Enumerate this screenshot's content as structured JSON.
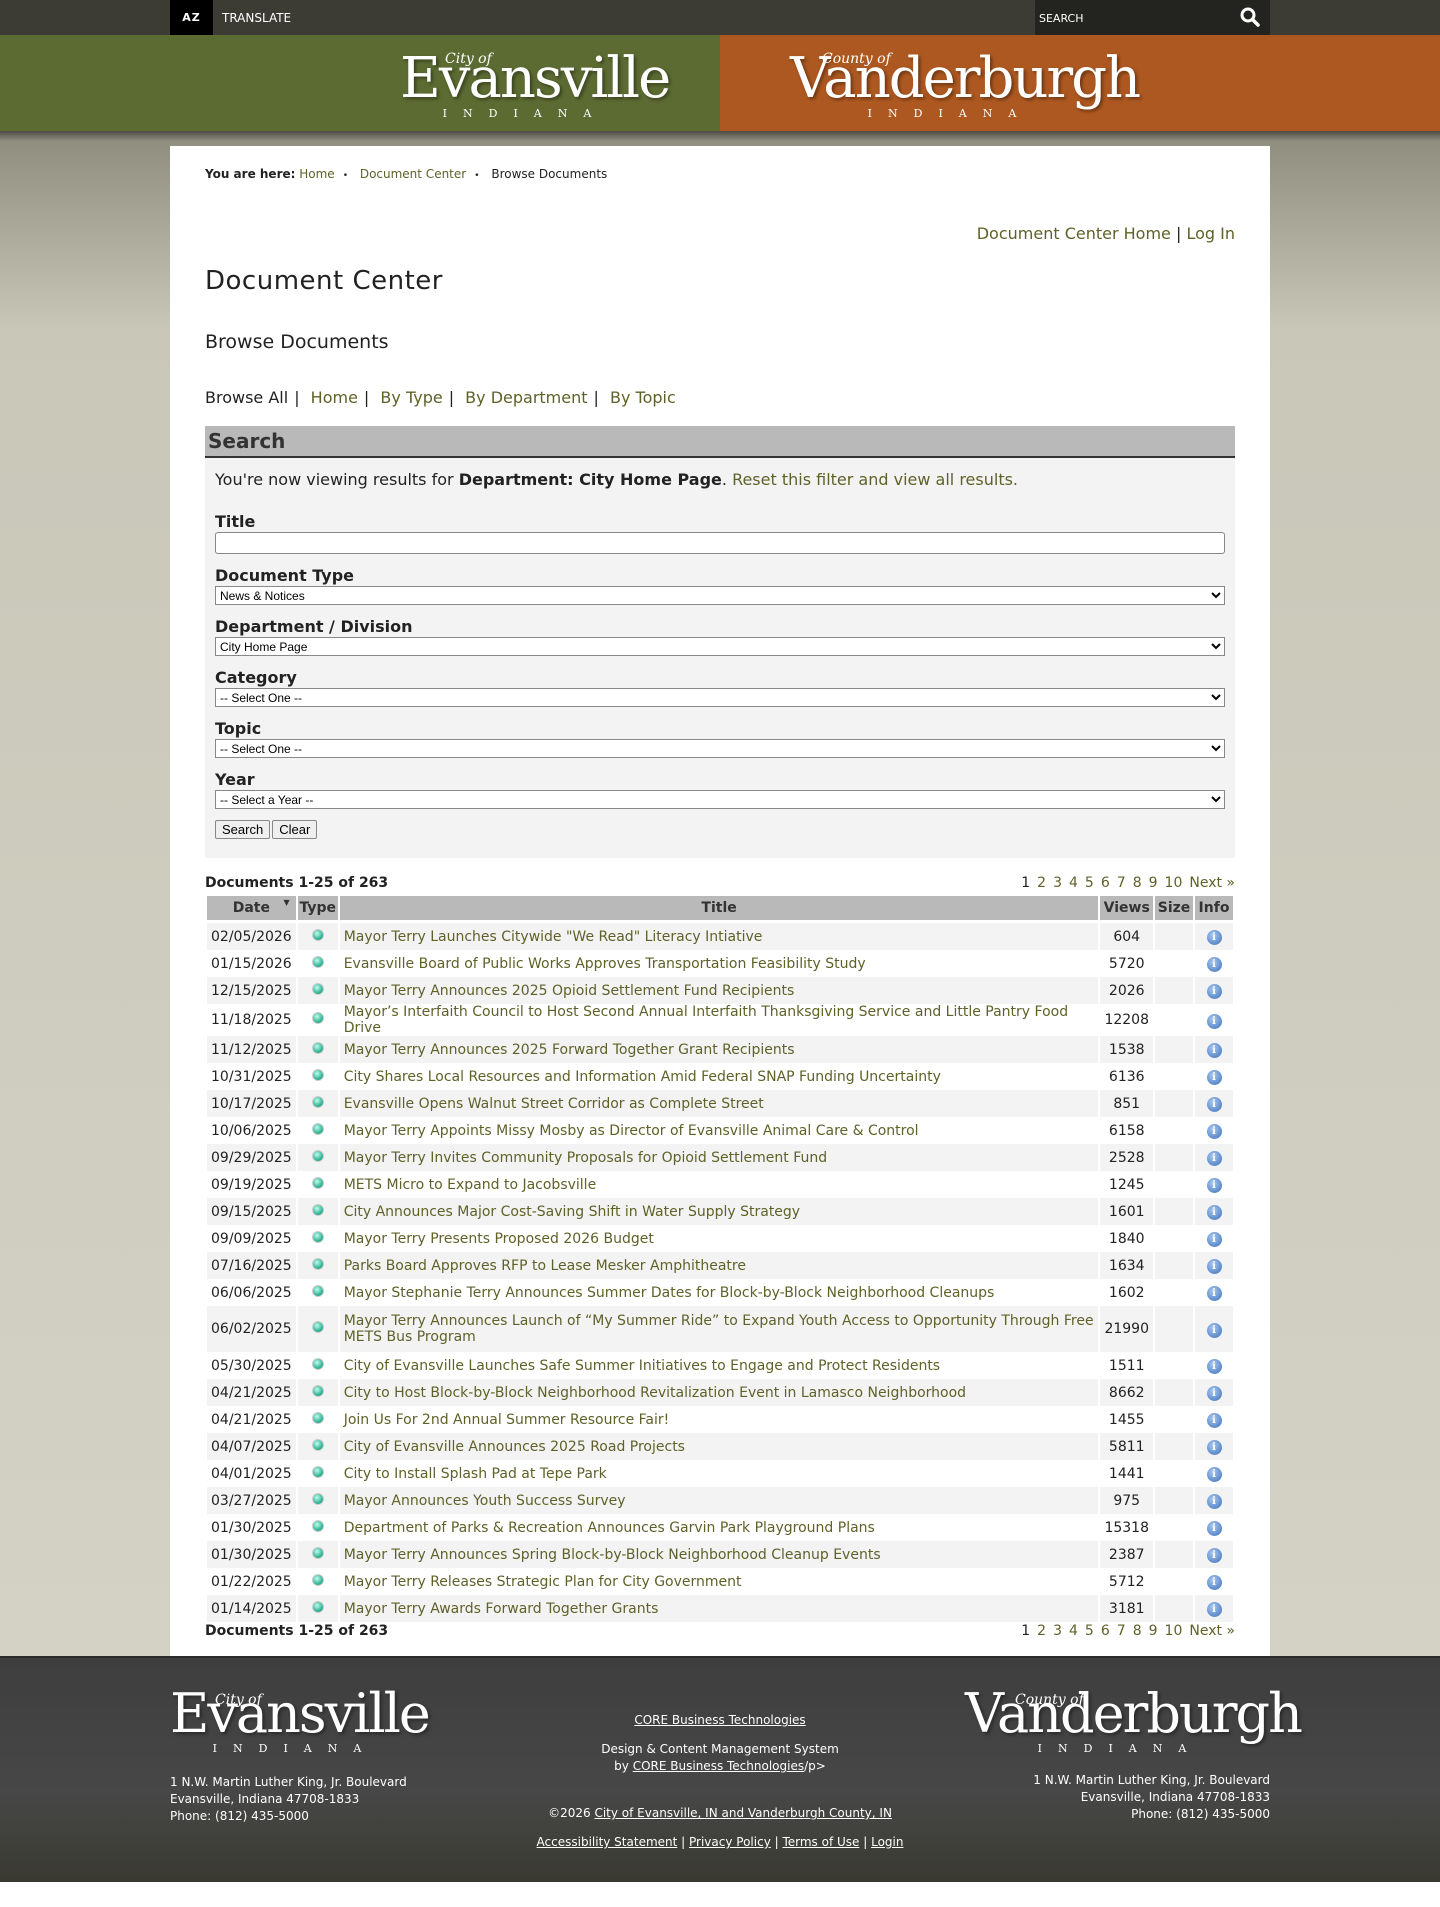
{
  "topbar": {
    "translate": "TRANSLATE",
    "translate_icon": "AZ",
    "search_placeholder": "SEARCH"
  },
  "logos": {
    "city_of": "City of",
    "evansville": "Evansville",
    "county_of": "County of",
    "vanderburgh": "Vanderburgh",
    "indiana": "INDIANA"
  },
  "breadcrumb": {
    "label": "You are here:",
    "items": [
      "Home",
      "Document Center",
      "Browse Documents"
    ]
  },
  "top_links": [
    "Document Center Home",
    "Log In"
  ],
  "page_title": "Document Center",
  "subtitle": "Browse Documents",
  "browse": {
    "current": "Browse All",
    "links": [
      "Home",
      "By Type",
      "By Department",
      "By Topic"
    ]
  },
  "search": {
    "heading": "Search",
    "msg_prefix": "You're now viewing results for ",
    "msg_bold": "Department: City Home Page",
    "msg_link": "Reset this filter and view all results.",
    "title_label": "Title",
    "title_value": "",
    "doctype_label": "Document Type",
    "doctype_value": "News & Notices",
    "dept_label": "Department / Division",
    "dept_value": "City Home Page",
    "category_label": "Category",
    "category_value": "-- Select One --",
    "topic_label": "Topic",
    "topic_value": "-- Select One --",
    "year_label": "Year",
    "year_value": "-- Select a Year --",
    "search_btn": "Search",
    "clear_btn": "Clear"
  },
  "results": {
    "count": "Documents 1-25 of 263",
    "pages": [
      "1",
      "2",
      "3",
      "4",
      "5",
      "6",
      "7",
      "8",
      "9",
      "10"
    ],
    "next": "Next »",
    "columns": [
      "Date",
      "Type",
      "Title",
      "Views",
      "Size",
      "Info"
    ],
    "rows": [
      [
        "02/05/2026",
        "Mayor Terry Launches Citywide \"We Read\" Literacy Intiative",
        "604"
      ],
      [
        "01/15/2026",
        "Evansville Board of Public Works Approves Transportation Feasibility Study",
        "5720"
      ],
      [
        "12/15/2025",
        "Mayor Terry Announces 2025 Opioid Settlement Fund Recipients",
        "2026"
      ],
      [
        "11/18/2025",
        "Mayor’s Interfaith Council to Host Second Annual Interfaith Thanksgiving Service and Little Pantry Food Drive",
        "12208"
      ],
      [
        "11/12/2025",
        "Mayor Terry Announces 2025 Forward Together Grant Recipients",
        "1538"
      ],
      [
        "10/31/2025",
        "City Shares Local Resources and Information Amid Federal SNAP Funding Uncertainty",
        "6136"
      ],
      [
        "10/17/2025",
        "Evansville Opens Walnut Street Corridor as Complete Street",
        "851"
      ],
      [
        "10/06/2025",
        "Mayor Terry Appoints Missy Mosby as Director of Evansville Animal Care & Control",
        "6158"
      ],
      [
        "09/29/2025",
        "Mayor Terry Invites Community Proposals for Opioid Settlement Fund",
        "2528"
      ],
      [
        "09/19/2025",
        "METS Micro to Expand to Jacobsville",
        "1245"
      ],
      [
        "09/15/2025",
        "City Announces Major Cost-Saving Shift in Water Supply Strategy",
        "1601"
      ],
      [
        "09/09/2025",
        "Mayor Terry Presents Proposed 2026 Budget",
        "1840"
      ],
      [
        "07/16/2025",
        "Parks Board Approves RFP to Lease Mesker Amphitheatre",
        "1634"
      ],
      [
        "06/06/2025",
        "Mayor Stephanie Terry Announces Summer Dates for Block-by-Block Neighborhood Cleanups",
        "1602"
      ],
      [
        "06/02/2025",
        "Mayor Terry Announces Launch of “My Summer Ride” to Expand Youth Access to Opportunity Through Free METS Bus Program",
        "21990"
      ],
      [
        "05/30/2025",
        "City of Evansville Launches Safe Summer Initiatives to Engage and Protect Residents",
        "1511"
      ],
      [
        "04/21/2025",
        "City to Host Block-by-Block Neighborhood Revitalization Event in Lamasco Neighborhood",
        "8662"
      ],
      [
        "04/21/2025",
        "Join Us For 2nd Annual Summer Resource Fair!",
        "1455"
      ],
      [
        "04/07/2025",
        "City of Evansville Announces 2025 Road Projects",
        "5811"
      ],
      [
        "04/01/2025",
        "City to Install Splash Pad at Tepe Park",
        "1441"
      ],
      [
        "03/27/2025",
        "Mayor Announces Youth Success Survey",
        "975"
      ],
      [
        "01/30/2025",
        "Department of Parks & Recreation Announces Garvin Park Playground Plans",
        "15318"
      ],
      [
        "01/30/2025",
        "Mayor Terry Announces Spring Block-by-Block Neighborhood Cleanup Events",
        "2387"
      ],
      [
        "01/22/2025",
        "Mayor Terry Releases Strategic Plan for City Government",
        "5712"
      ],
      [
        "01/14/2025",
        "Mayor Terry Awards Forward Together Grants",
        "3181"
      ]
    ]
  },
  "footer": {
    "address": [
      "1 N.W. Martin Luther King, Jr. Boulevard",
      "Evansville, Indiana 47708-1833",
      "Phone: (812) 435-5000"
    ],
    "core_link": "CORE Business Technologies",
    "design_line": "Design & Content Management System",
    "by": "by ",
    "by_suffix": "/p>",
    "copyright": "©2026 ",
    "copyright_link": "City of Evansville, IN and Vanderburgh County, IN",
    "links": [
      "Accessibility Statement",
      "Privacy Policy",
      "Terms of Use",
      "Login"
    ]
  },
  "colors": {
    "green": "#5c6b32",
    "orange": "#ad5820",
    "link": "#5f6128"
  }
}
